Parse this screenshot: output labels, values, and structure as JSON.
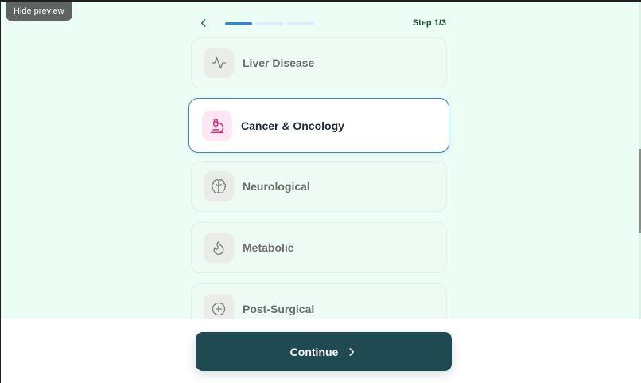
{
  "preview": {
    "hide_label": "Hide preview"
  },
  "header": {
    "step_label": "Step 1/3",
    "progress": {
      "total": 3,
      "current": 1
    }
  },
  "conditions": [
    {
      "label": "Liver Disease",
      "icon": "activity-icon"
    },
    {
      "label": "Cancer & Oncology",
      "icon": "microscope-icon",
      "selected": true
    },
    {
      "label": "Neurological",
      "icon": "brain-icon"
    },
    {
      "label": "Metabolic",
      "icon": "flame-icon"
    },
    {
      "label": "Post-Surgical",
      "icon": "plus-circle-icon"
    }
  ],
  "footer": {
    "continue_label": "Continue"
  },
  "colors": {
    "background": "#ecfdf5",
    "accent_blue": "#3b82c4",
    "button": "#1f4a52",
    "selected_icon": "#db2777"
  }
}
